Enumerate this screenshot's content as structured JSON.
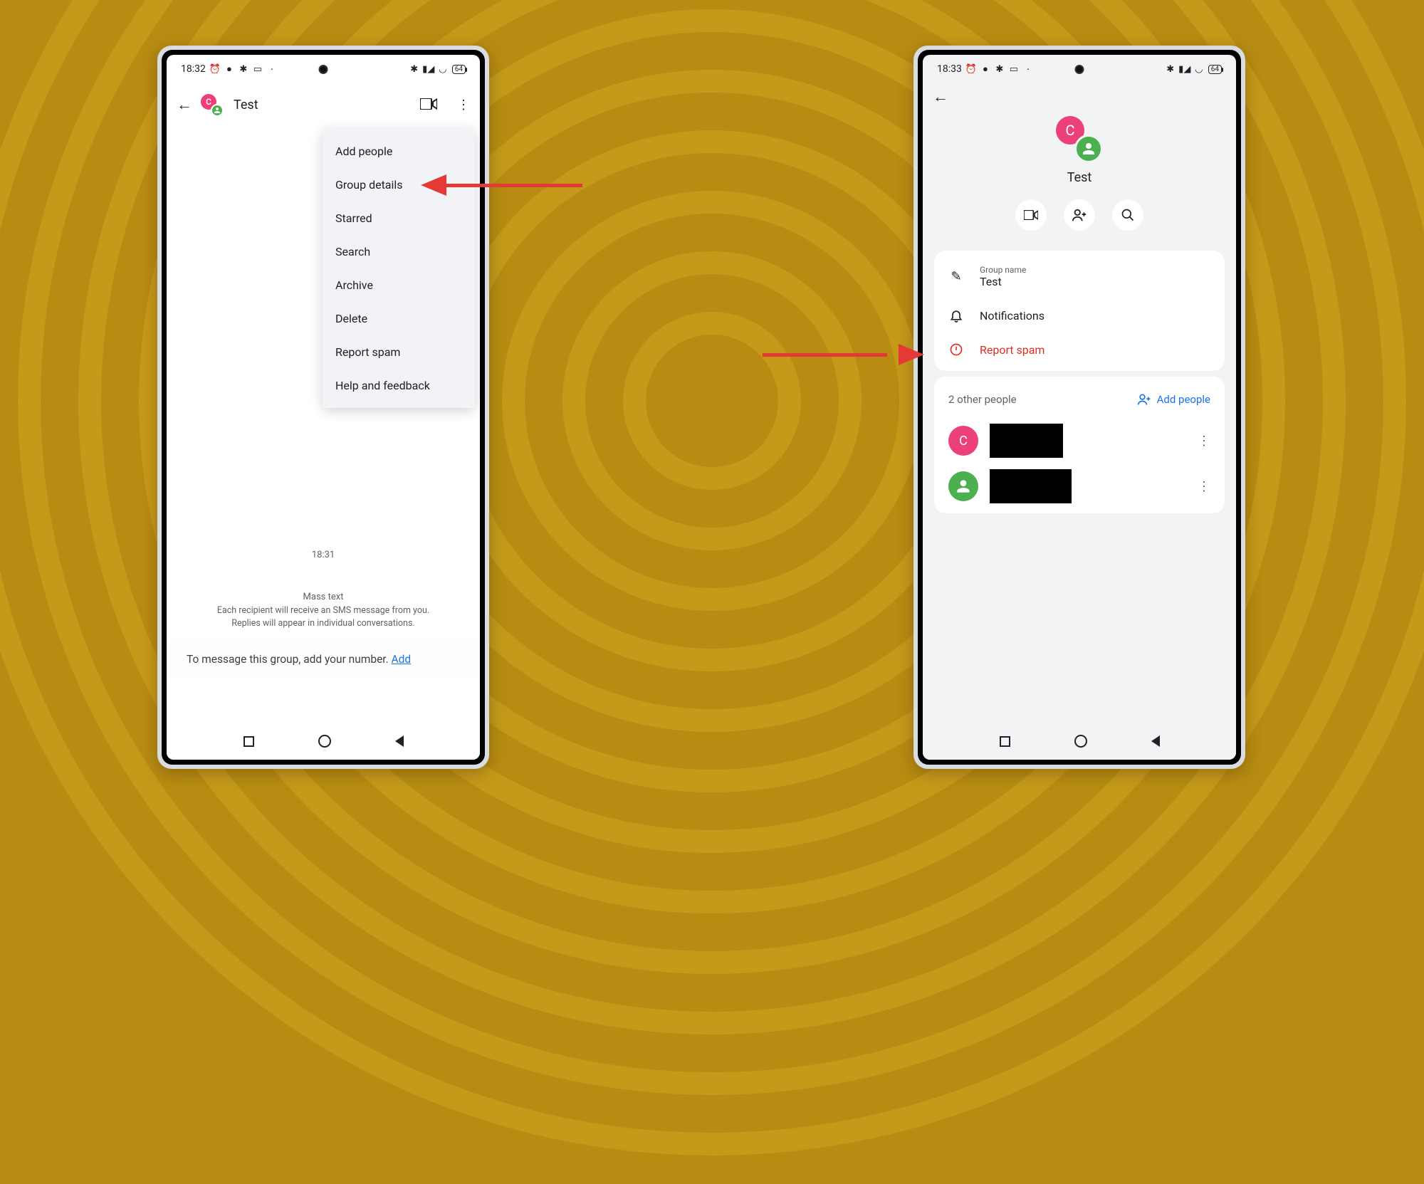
{
  "left": {
    "status_time": "18:32",
    "battery": "64",
    "chat_title": "Test",
    "avatar_letter": "C",
    "dropdown": [
      "Add people",
      "Group details",
      "Starred",
      "Search",
      "Archive",
      "Delete",
      "Report spam",
      "Help and feedback"
    ],
    "timestamp": "18:31",
    "mass_title": "Mass text",
    "mass_line1": "Each recipient will receive an SMS message from you.",
    "mass_line2": "Replies will appear in individual conversations.",
    "add_prompt": "To message this group, add your number. ",
    "add_link": "Add"
  },
  "right": {
    "status_time": "18:33",
    "battery": "64",
    "title": "Test",
    "avatar_letter": "C",
    "group_name_label": "Group name",
    "group_name": "Test",
    "notifications": "Notifications",
    "report_spam": "Report spam",
    "people_count": "2 other people",
    "add_people": "Add people",
    "person1_letter": "C"
  }
}
